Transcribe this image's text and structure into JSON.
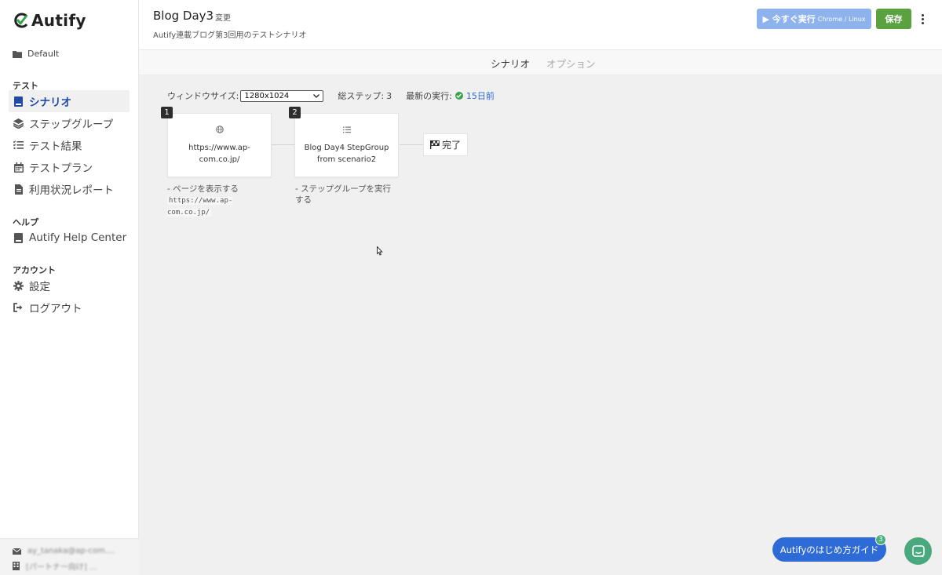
{
  "app": {
    "name": "Autify"
  },
  "sidebar": {
    "project": "Default",
    "sections": [
      {
        "heading": "テスト",
        "items": [
          {
            "label": "シナリオ",
            "icon": "book-icon",
            "active": true
          },
          {
            "label": "ステップグループ",
            "icon": "layers-icon"
          },
          {
            "label": "テスト結果",
            "icon": "list-check-icon"
          },
          {
            "label": "テストプラン",
            "icon": "calendar-icon"
          },
          {
            "label": "利用状況レポート",
            "icon": "file-icon"
          }
        ]
      },
      {
        "heading": "ヘルプ",
        "items": [
          {
            "label": "Autify Help Center",
            "icon": "book-icon"
          }
        ]
      },
      {
        "heading": "アカウント",
        "items": [
          {
            "label": "設定",
            "icon": "gear-icon"
          },
          {
            "label": "ログアウト",
            "icon": "logout-icon"
          }
        ]
      }
    ],
    "user": {
      "email": "ay_tanaka@ap-com....",
      "org": "[パートナー向け] ..."
    }
  },
  "header": {
    "title": "Blog Day3",
    "edit_label": "変更",
    "description": "Autify連載ブログ第3回用のテストシナリオ",
    "run_label": "▶ 今すぐ実行",
    "run_env": "Chrome / Linux",
    "save_label": "保存"
  },
  "tabs": [
    {
      "label": "シナリオ",
      "active": true
    },
    {
      "label": "オプション",
      "active": false
    }
  ],
  "scenario": {
    "window_size_label": "ウィンドウサイズ:",
    "window_size_value": "1280x1024",
    "total_steps_label": "総ステップ:",
    "total_steps_value": "3",
    "last_run_label": "最新の実行:",
    "last_run_value": "15日前",
    "steps": [
      {
        "number": "1",
        "title": "https://www.ap-com.co.jp/",
        "icon": "globe-icon",
        "desc_prefix": "- ページを表示する",
        "desc_code": "https://www.ap-com.co.jp/"
      },
      {
        "number": "2",
        "title": "Blog Day4 StepGroup from scenario2",
        "icon": "list-icon",
        "desc_prefix": "- ステップグループを実行する",
        "desc_code": ""
      }
    ],
    "done_label": "完了"
  },
  "guide": {
    "label": "Autifyのはじめ方ガイド",
    "count": "3"
  },
  "colors": {
    "primary": "#2f6bd6",
    "success": "#5aa240",
    "run_disabled": "#8eb2ee",
    "chat": "#4aa87f"
  }
}
